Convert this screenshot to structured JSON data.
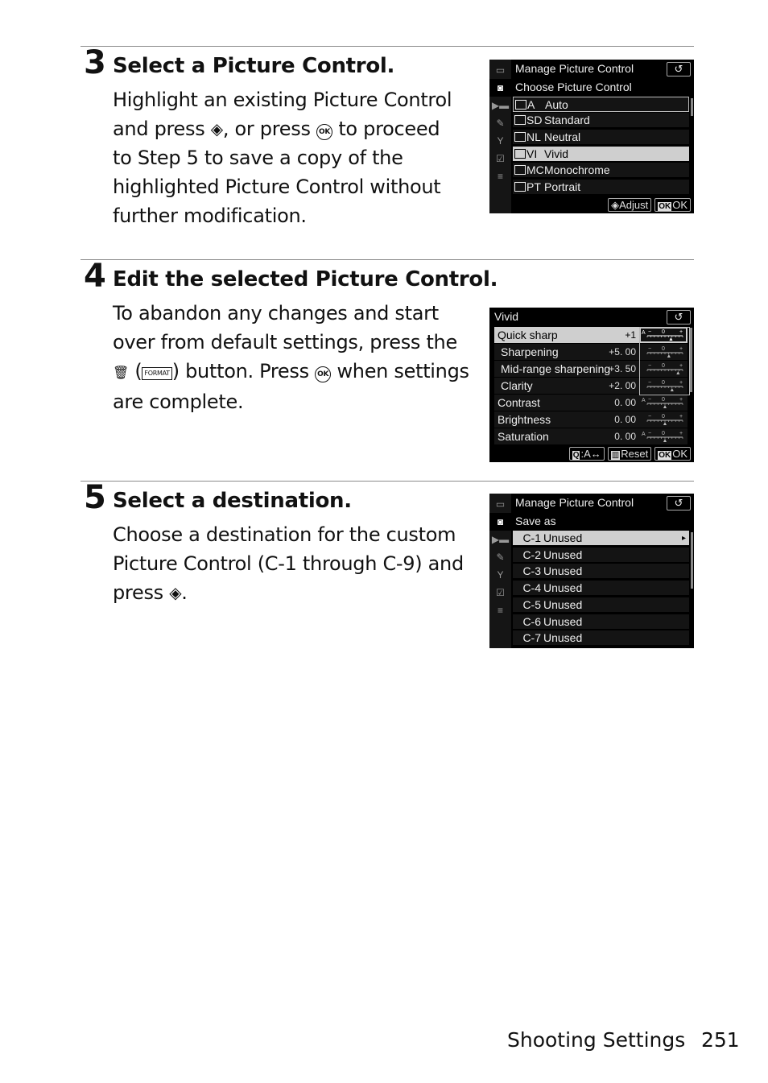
{
  "steps": [
    {
      "number": "3",
      "title": "Select a Picture Control.",
      "body": {
        "line1": "Highlight an existing Picture Control",
        "line2_a": "and press ",
        "line2_b": ", or press ",
        "line2_c": " to proceed",
        "line3": "to Step 5 to save a copy of the",
        "line4": "highlighted Picture Control without",
        "line5": "further modification."
      }
    },
    {
      "number": "4",
      "title": "Edit the selected Picture Control.",
      "body": {
        "line1": "To abandon any changes and start",
        "line2": "over from default settings, press the",
        "line3_a": " (",
        "line3_b": ") button. Press ",
        "line3_c": " when settings",
        "line4": "are complete."
      }
    },
    {
      "number": "5",
      "title": "Select a destination.",
      "body": {
        "line1": "Choose a destination for the custom",
        "line2": "Picture Control (C-1 through C-9) and",
        "line3_a": "press ",
        "line3_b": "."
      }
    }
  ],
  "icons": {
    "multi_selector_right": "◈",
    "ok_button": "OK",
    "trash": "🗑",
    "format": "FORMAT"
  },
  "screen1": {
    "title": "Manage Picture Control",
    "subtitle": "Choose Picture Control",
    "back": "↺",
    "items": [
      {
        "code": "A",
        "label": "Auto",
        "state": "outlined"
      },
      {
        "code": "SD",
        "label": "Standard",
        "state": ""
      },
      {
        "code": "NL",
        "label": "Neutral",
        "state": ""
      },
      {
        "code": "VI",
        "label": "Vivid",
        "state": "selected"
      },
      {
        "code": "MC",
        "label": "Monochrome",
        "state": ""
      },
      {
        "code": "PT",
        "label": "Portrait",
        "state": ""
      }
    ],
    "footer": {
      "adjust": "Adjust",
      "ok": "OK",
      "ok_badge": "OK"
    }
  },
  "screen2": {
    "title": "Vivid",
    "back": "↺",
    "items": [
      {
        "label": "Quick sharp",
        "value": "+1",
        "indent": false,
        "selected": true,
        "auto": true,
        "marker": 0.67
      },
      {
        "label": "Sharpening",
        "value": "+5. 00",
        "indent": true,
        "selected": false,
        "auto": false,
        "marker": 0.61
      },
      {
        "label": "Mid-range sharpening",
        "value": "+3. 50",
        "indent": true,
        "selected": false,
        "auto": false,
        "marker": 0.87
      },
      {
        "label": "Clarity",
        "value": "+2. 00",
        "indent": true,
        "selected": false,
        "auto": false,
        "marker": 0.7
      },
      {
        "label": "Contrast",
        "value": "0. 00",
        "indent": false,
        "selected": false,
        "auto": true,
        "marker": 0.5
      },
      {
        "label": "Brightness",
        "value": "0. 00",
        "indent": false,
        "selected": false,
        "auto": false,
        "marker": 0.5
      },
      {
        "label": "Saturation",
        "value": "0. 00",
        "indent": false,
        "selected": false,
        "auto": true,
        "marker": 0.5
      }
    ],
    "gauge": {
      "minus": "−",
      "zero": "0",
      "plus": "+",
      "auto": "A"
    },
    "footer": {
      "zoom": ":A↔",
      "reset": "Reset",
      "ok": "OK",
      "ok_badge": "OK"
    }
  },
  "screen3": {
    "title": "Manage Picture Control",
    "subtitle": "Save as",
    "back": "↺",
    "items": [
      {
        "code": "C-1",
        "label": "Unused",
        "selected": true
      },
      {
        "code": "C-2",
        "label": "Unused",
        "selected": false
      },
      {
        "code": "C-3",
        "label": "Unused",
        "selected": false
      },
      {
        "code": "C-4",
        "label": "Unused",
        "selected": false
      },
      {
        "code": "C-5",
        "label": "Unused",
        "selected": false
      },
      {
        "code": "C-6",
        "label": "Unused",
        "selected": false
      },
      {
        "code": "C-7",
        "label": "Unused",
        "selected": false
      }
    ],
    "arrow": "▸"
  },
  "sidebar_icons": [
    "▶",
    "◘",
    "▶▬",
    "✎",
    "Y",
    "☑",
    "≡"
  ],
  "footer": {
    "section": "Shooting Settings",
    "page": "251"
  }
}
